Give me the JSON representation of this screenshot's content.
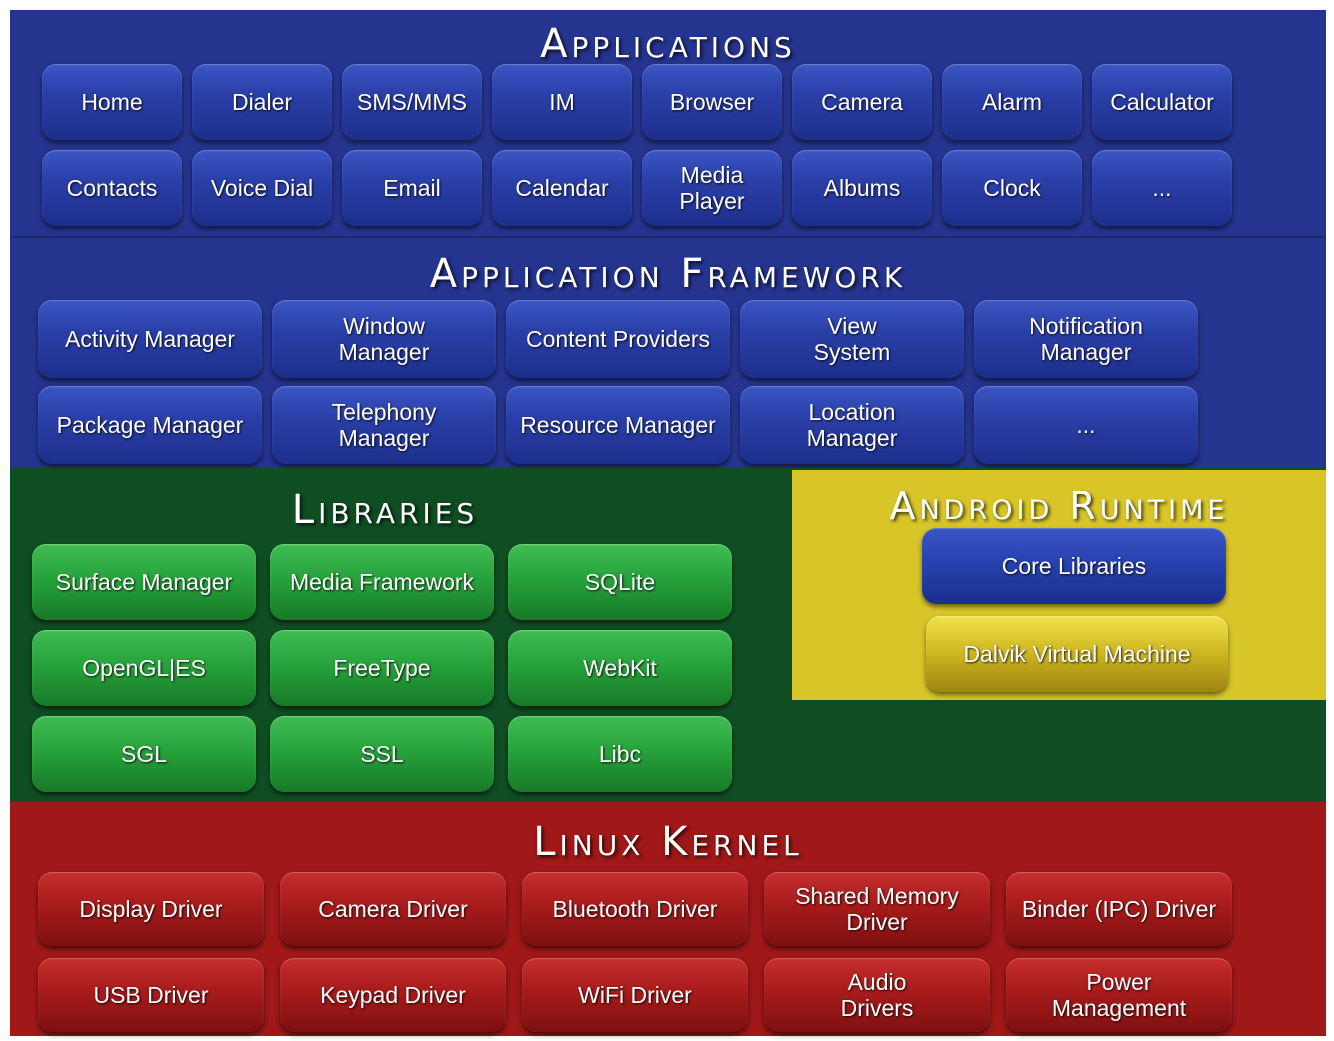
{
  "colors": {
    "applications_bg": "#25348f",
    "framework_bg": "#25348f",
    "libraries_bg": "#0f4e22",
    "runtime_bg": "#d8c528",
    "kernel_bg": "#a01818"
  },
  "applications": {
    "title": "Applications",
    "rows": [
      [
        "Home",
        "Dialer",
        "SMS/MMS",
        "IM",
        "Browser",
        "Camera",
        "Alarm",
        "Calculator"
      ],
      [
        "Contacts",
        "Voice Dial",
        "Email",
        "Calendar",
        "Media Player",
        "Albums",
        "Clock",
        "..."
      ]
    ]
  },
  "framework": {
    "title": "Application Framework",
    "rows": [
      [
        "Activity Manager",
        "Window\nManager",
        "Content Providers",
        "View\nSystem",
        "Notification\nManager"
      ],
      [
        "Package Manager",
        "Telephony\nManager",
        "Resource Manager",
        "Location\nManager",
        "..."
      ]
    ]
  },
  "libraries": {
    "title": "Libraries",
    "rows": [
      [
        "Surface Manager",
        "Media Framework",
        "SQLite"
      ],
      [
        "OpenGL|ES",
        "FreeType",
        "WebKit"
      ],
      [
        "SGL",
        "SSL",
        "Libc"
      ]
    ]
  },
  "runtime": {
    "title": "Android Runtime",
    "items": [
      "Core Libraries",
      "Dalvik Virtual Machine"
    ]
  },
  "kernel": {
    "title": "Linux Kernel",
    "rows": [
      [
        "Display Driver",
        "Camera Driver",
        "Bluetooth Driver",
        "Shared Memory\nDriver",
        "Binder (IPC) Driver"
      ],
      [
        "USB Driver",
        "Keypad Driver",
        "WiFi Driver",
        "Audio\nDrivers",
        "Power\nManagement"
      ]
    ]
  }
}
